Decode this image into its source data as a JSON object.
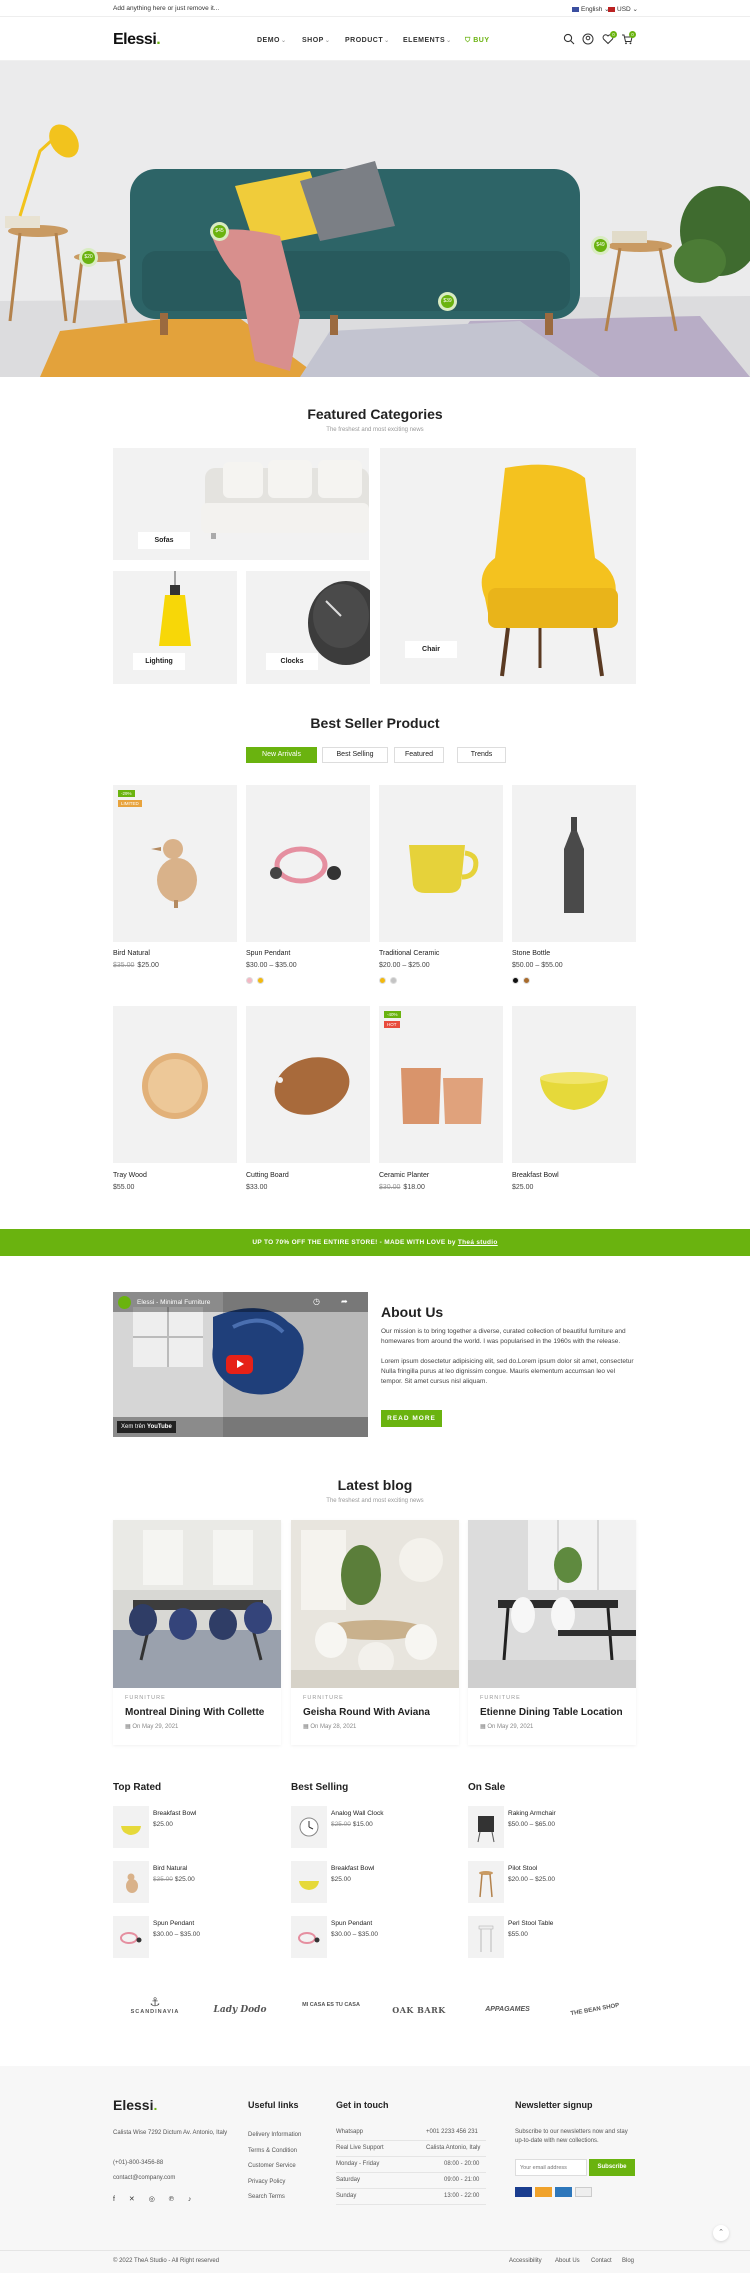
{
  "topbar": {
    "promo": "Add anything here or just remove it...",
    "language": "English",
    "currency": "USD"
  },
  "header": {
    "logo": "Elessi",
    "nav": [
      "DEMO",
      "SHOP",
      "PRODUCT",
      "ELEMENTS"
    ],
    "buy": "BUY",
    "wishlist_count": "0",
    "cart_count": "0"
  },
  "hero": {
    "pins": [
      "$20",
      "$45",
      "$39",
      "$49"
    ]
  },
  "featured": {
    "title": "Featured Categories",
    "subtitle": "The freshest and most exciting news",
    "categories": [
      "Sofas",
      "Chair",
      "Lighting",
      "Clocks"
    ]
  },
  "bestseller": {
    "title": "Best Seller Product",
    "tabs": [
      "New Arrivals",
      "Best Selling",
      "Featured",
      "Trends"
    ],
    "products": [
      {
        "name": "Bird Natural",
        "old": "$35.00",
        "price": "$25.00",
        "tags": [
          "-29%",
          "LIMITED"
        ]
      },
      {
        "name": "Spun Pendant",
        "old": "",
        "price": "$30.00 – $35.00",
        "tags": []
      },
      {
        "name": "Traditional Ceramic",
        "old": "",
        "price": "$20.00 – $25.00",
        "tags": []
      },
      {
        "name": "Stone Bottle",
        "old": "",
        "price": "$50.00 – $55.00",
        "tags": []
      },
      {
        "name": "Tray Wood",
        "old": "",
        "price": "$55.00",
        "tags": []
      },
      {
        "name": "Cutting Board",
        "old": "",
        "price": "$33.00",
        "tags": []
      },
      {
        "name": "Ceramic Planter",
        "old": "$30.00",
        "price": "$18.00",
        "tags": [
          "-40%",
          "HOT"
        ]
      },
      {
        "name": "Breakfast Bowl",
        "old": "",
        "price": "$25.00",
        "tags": []
      }
    ]
  },
  "banner": {
    "text_a": "UP TO 70% OFF THE ENTIRE STORE! - MADE WITH LOVE by ",
    "text_b": "Theá studio"
  },
  "about": {
    "video_title": "Elessi - Minimal Furniture",
    "video_watch": "Xem trên",
    "video_youtube": "YouTube",
    "title": "About Us",
    "p1": "Our mission is to bring together a diverse, curated collection of beautiful furniture and homewares from around the world. I was popularised in the 1960s with the release.",
    "p2": "Lorem ipsum dosectetur adipisicing elit, sed do.Lorem ipsum dolor sit amet, consectetur Nulla fringilla purus at leo dignissim congue. Mauris elementum accumsan leo vel tempor. Sit amet cursus nisl aliquam.",
    "button": "READ MORE"
  },
  "blog": {
    "title": "Latest blog",
    "subtitle": "The freshest and most exciting news",
    "posts": [
      {
        "cat": "FURNITURE",
        "title": "Montreal Dining With Collette",
        "date": "On May 29, 2021"
      },
      {
        "cat": "FURNITURE",
        "title": "Geisha Round With Aviana",
        "date": "On May 28, 2021"
      },
      {
        "cat": "FURNITURE",
        "title": "Etienne Dining Table Location",
        "date": "On May 29, 2021"
      }
    ]
  },
  "lists": {
    "top_rated": {
      "title": "Top Rated",
      "items": [
        {
          "name": "Breakfast Bowl",
          "old": "",
          "price": "$25.00"
        },
        {
          "name": "Bird Natural",
          "old": "$35.00",
          "price": "$25.00"
        },
        {
          "name": "Spun Pendant",
          "old": "",
          "price": "$30.00 – $35.00"
        }
      ]
    },
    "best_selling": {
      "title": "Best Selling",
      "items": [
        {
          "name": "Analog Wall Clock",
          "old": "$25.00",
          "price": "$15.00"
        },
        {
          "name": "Breakfast Bowl",
          "old": "",
          "price": "$25.00"
        },
        {
          "name": "Spun Pendant",
          "old": "",
          "price": "$30.00 – $35.00"
        }
      ]
    },
    "on_sale": {
      "title": "On Sale",
      "items": [
        {
          "name": "Raking Armchair",
          "old": "",
          "price": "$50.00 – $65.00"
        },
        {
          "name": "Pilot Stool",
          "old": "",
          "price": "$20.00 – $25.00"
        },
        {
          "name": "Perl Stool Table",
          "old": "",
          "price": "$55.00"
        }
      ]
    }
  },
  "brands": [
    "SCANDINAVIA",
    "Lady Dodo",
    "MI CASA ES TU CASA",
    "OAK BARK",
    "APPAGAMES",
    "THE BEAN SHOP"
  ],
  "footer": {
    "logo": "Elessi",
    "address": "Calista Wise 7292 Dictum Av. Antonio, Italy",
    "phone": "(+01)-800-3456-88",
    "email": "contact@company.com",
    "useful_title": "Useful links",
    "useful": [
      "Delivery Information",
      "Terms & Condition",
      "Customer Service",
      "Privacy Policy",
      "Search Terms"
    ],
    "touch_title": "Get in touch",
    "touch": [
      [
        "Whatsapp",
        "+001 2233 456 231"
      ],
      [
        "Real Live Support",
        "Calista Antonio, Italy"
      ],
      [
        "Monday - Friday",
        "08:00 - 20:00"
      ],
      [
        "Saturday",
        "09:00 - 21:00"
      ],
      [
        "Sunday",
        "13:00 - 22:00"
      ]
    ],
    "news_title": "Newsletter signup",
    "news_text": "Subscribe to our newsletters now and stay up-to-date with new collections.",
    "email_placeholder": "Your email address",
    "subscribe": "Subscribe",
    "copyright": "© 2022 TheA Studio - All Right reserved",
    "bottom_links": [
      "Accessibility",
      "About Us",
      "Contact",
      "Blog"
    ]
  },
  "colors": {
    "accent": "#6ab30f"
  }
}
